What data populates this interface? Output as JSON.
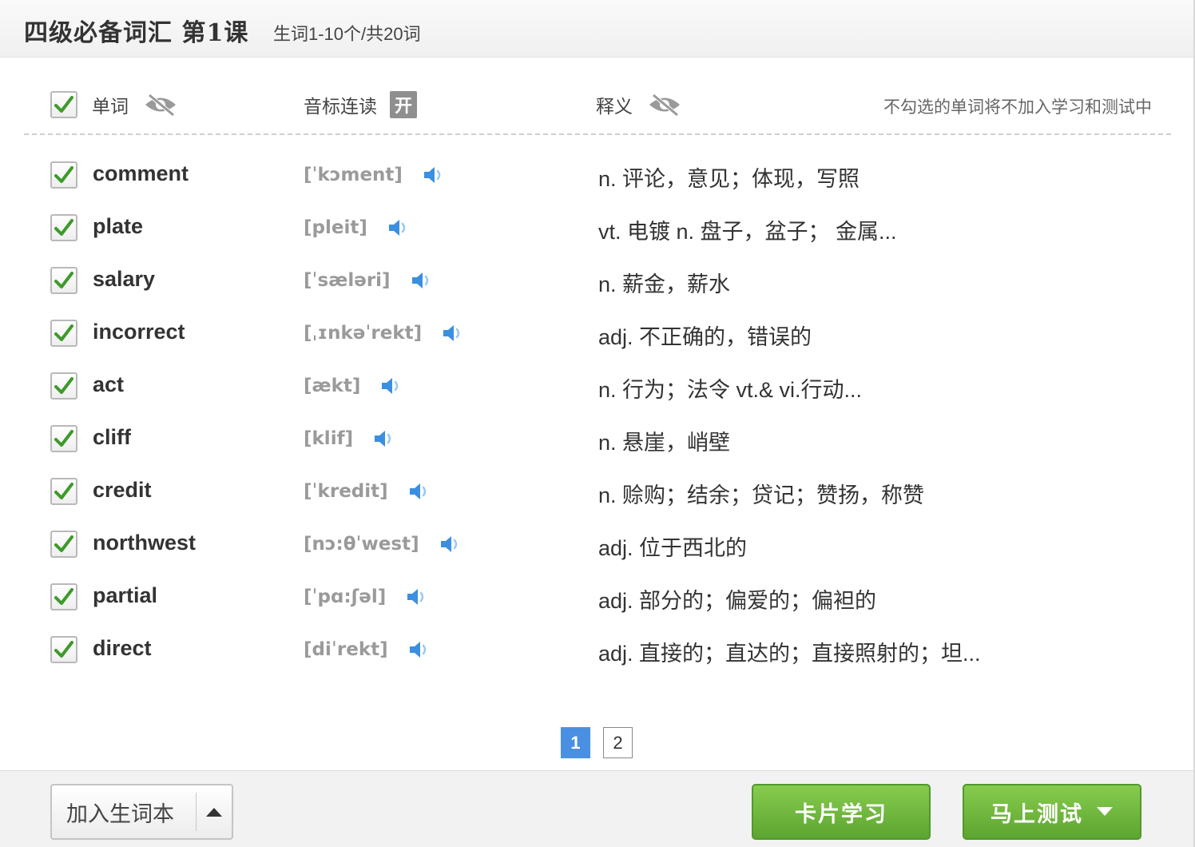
{
  "header": {
    "title": "四级必备词汇 第1课",
    "subtitle": "生词1-10个/共20词"
  },
  "columns": {
    "word_label": "单词",
    "phonetic_label": "音标连读",
    "phonetic_toggle": "开",
    "definition_label": "释义",
    "hint": "不勾选的单词将不加入学习和测试中"
  },
  "words": [
    {
      "word": "comment",
      "phonetic": "[ˈkɔment]",
      "definition": "n. 评论，意见；体现，写照",
      "checked": true
    },
    {
      "word": "plate",
      "phonetic": "[pleit]",
      "definition": "vt. 电镀 n. 盘子，盆子； 金属...",
      "checked": true
    },
    {
      "word": "salary",
      "phonetic": "[ˈsæləri]",
      "definition": "n. 薪金，薪水",
      "checked": true
    },
    {
      "word": "incorrect",
      "phonetic": "[ˌɪnkəˈrekt]",
      "definition": "adj. 不正确的，错误的",
      "checked": true
    },
    {
      "word": "act",
      "phonetic": "[ækt]",
      "definition": "n. 行为；法令 vt.& vi.行动...",
      "checked": true
    },
    {
      "word": "cliff",
      "phonetic": "[klif]",
      "definition": "n. 悬崖，峭壁",
      "checked": true
    },
    {
      "word": "credit",
      "phonetic": "[ˈkredit]",
      "definition": "n. 赊购；结余；贷记；赞扬，称赞",
      "checked": true
    },
    {
      "word": "northwest",
      "phonetic": "[nɔ:θˈwest]",
      "definition": "adj. 位于西北的",
      "checked": true
    },
    {
      "word": "partial",
      "phonetic": "[ˈpɑ:ʃəl]",
      "definition": "adj. 部分的；偏爱的；偏袒的",
      "checked": true
    },
    {
      "word": "direct",
      "phonetic": "[diˈrekt]",
      "definition": "adj. 直接的；直达的；直接照射的；坦...",
      "checked": true
    }
  ],
  "pagination": {
    "pages": [
      "1",
      "2"
    ],
    "current": "1"
  },
  "footer": {
    "add_label": "加入生词本",
    "card_label": "卡片学习",
    "test_label": "马上测试"
  },
  "colors": {
    "accent_blue": "#4a90e2",
    "green_button": "#6cb33f",
    "check_green": "#3d9a2a"
  }
}
